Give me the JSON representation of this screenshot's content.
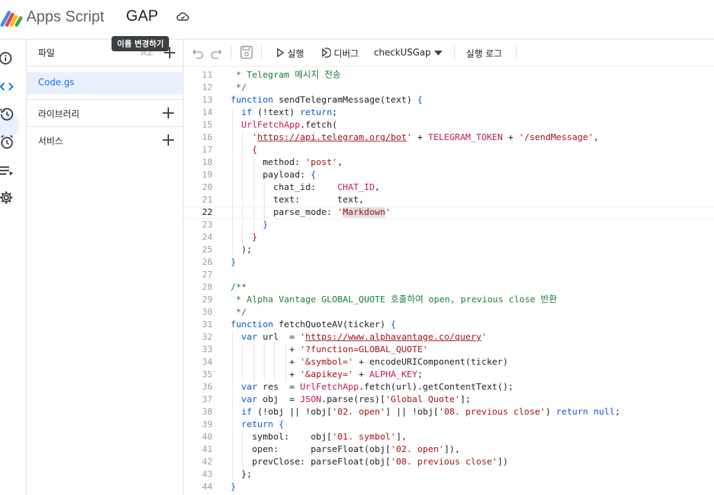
{
  "header": {
    "app_name": "Apps Script",
    "project_name": "GAP",
    "rename_tooltip": "이름 변경하기"
  },
  "rail": {
    "icons": [
      "info-icon",
      "code-icon",
      "history-icon",
      "triggers-icon",
      "executions-icon",
      "settings-icon"
    ],
    "active": "code-icon"
  },
  "file_panel": {
    "files_label": "파일",
    "sort_label": "AZ",
    "files": [
      "Code.gs"
    ],
    "libraries_label": "라이브러리",
    "services_label": "서비스"
  },
  "toolbar": {
    "run_label": "실행",
    "debug_label": "디버그",
    "function_selected": "checkUSGap",
    "exec_log_label": "실행 로그"
  },
  "editor": {
    "current_line": 22,
    "lines": [
      {
        "n": "11",
        "indent": 0,
        "tokens": [
          [
            " * Telegram 메시지 전송",
            "cm"
          ]
        ]
      },
      {
        "n": "12",
        "indent": 0,
        "tokens": [
          [
            " */",
            "cm"
          ]
        ]
      },
      {
        "n": "13",
        "indent": 0,
        "tokens": [
          [
            "function",
            "kw"
          ],
          [
            " sendTelegramMessage(text) ",
            "plain"
          ],
          [
            "{",
            "brace"
          ]
        ]
      },
      {
        "n": "14",
        "indent": 1,
        "tokens": [
          [
            "  ",
            "plain"
          ],
          [
            "if",
            "kw"
          ],
          [
            " (!text) ",
            "plain"
          ],
          [
            "return",
            "kw"
          ],
          [
            ";",
            "plain"
          ]
        ]
      },
      {
        "n": "15",
        "indent": 1,
        "tokens": [
          [
            "  ",
            "plain"
          ],
          [
            "UrlFetchApp",
            "const"
          ],
          [
            ".fetch(",
            "plain"
          ]
        ]
      },
      {
        "n": "16",
        "indent": 2,
        "tokens": [
          [
            "    '",
            "str"
          ],
          [
            "https://api.telegram.org/bot",
            "url"
          ],
          [
            "'",
            "str"
          ],
          [
            " + ",
            "plain"
          ],
          [
            "TELEGRAM_TOKEN",
            "const"
          ],
          [
            " + ",
            "plain"
          ],
          [
            "'/sendMessage'",
            "str"
          ],
          [
            ",",
            "plain"
          ]
        ]
      },
      {
        "n": "17",
        "indent": 2,
        "tokens": [
          [
            "    {",
            "str"
          ]
        ]
      },
      {
        "n": "18",
        "indent": 3,
        "tokens": [
          [
            "      method: ",
            "plain"
          ],
          [
            "'post'",
            "str"
          ],
          [
            ",",
            "plain"
          ]
        ]
      },
      {
        "n": "19",
        "indent": 3,
        "tokens": [
          [
            "      payload: ",
            "plain"
          ],
          [
            "{",
            "brace"
          ]
        ]
      },
      {
        "n": "20",
        "indent": 4,
        "tokens": [
          [
            "        chat_id:    ",
            "plain"
          ],
          [
            "CHAT_ID",
            "const"
          ],
          [
            ",",
            "plain"
          ]
        ]
      },
      {
        "n": "21",
        "indent": 4,
        "tokens": [
          [
            "        text:       text,",
            "plain"
          ]
        ]
      },
      {
        "n": "22",
        "indent": 4,
        "tokens": [
          [
            "        parse_mode: ",
            "plain"
          ],
          [
            "'",
            "str"
          ],
          [
            "Markdown",
            "str-hl"
          ],
          [
            "'",
            "str"
          ]
        ]
      },
      {
        "n": "23",
        "indent": 3,
        "tokens": [
          [
            "      ",
            "plain"
          ],
          [
            "}",
            "brace"
          ]
        ]
      },
      {
        "n": "24",
        "indent": 2,
        "tokens": [
          [
            "    }",
            "str"
          ]
        ]
      },
      {
        "n": "25",
        "indent": 1,
        "tokens": [
          [
            "  );",
            "plain"
          ]
        ]
      },
      {
        "n": "26",
        "indent": 0,
        "tokens": [
          [
            "}",
            "brace"
          ]
        ]
      },
      {
        "n": "27",
        "indent": 0,
        "tokens": []
      },
      {
        "n": "28",
        "indent": 0,
        "tokens": [
          [
            "/**",
            "cm"
          ]
        ]
      },
      {
        "n": "29",
        "indent": 0,
        "tokens": [
          [
            " * Alpha Vantage GLOBAL_QUOTE 호출하여 open, previous close 반환",
            "cm"
          ]
        ]
      },
      {
        "n": "30",
        "indent": 0,
        "tokens": [
          [
            " */",
            "cm"
          ]
        ]
      },
      {
        "n": "31",
        "indent": 0,
        "tokens": [
          [
            "function",
            "kw"
          ],
          [
            " fetchQuoteAV(ticker) ",
            "plain"
          ],
          [
            "{",
            "brace"
          ]
        ]
      },
      {
        "n": "32",
        "indent": 1,
        "tokens": [
          [
            "  ",
            "plain"
          ],
          [
            "var",
            "kw"
          ],
          [
            " url  = ",
            "plain"
          ],
          [
            "'",
            "str"
          ],
          [
            "https://www.alphavantage.co/query",
            "url"
          ],
          [
            "'",
            "str"
          ]
        ]
      },
      {
        "n": "33",
        "indent": 6,
        "tokens": [
          [
            "           + ",
            "plain"
          ],
          [
            "'?function=GLOBAL_QUOTE'",
            "str"
          ]
        ]
      },
      {
        "n": "34",
        "indent": 6,
        "tokens": [
          [
            "           + ",
            "plain"
          ],
          [
            "'&symbol='",
            "str"
          ],
          [
            " + encodeURIComponent(ticker)",
            "plain"
          ]
        ]
      },
      {
        "n": "35",
        "indent": 6,
        "tokens": [
          [
            "           + ",
            "plain"
          ],
          [
            "'&apikey='",
            "str"
          ],
          [
            " + ",
            "plain"
          ],
          [
            "ALPHA_KEY",
            "const"
          ],
          [
            ";",
            "plain"
          ]
        ]
      },
      {
        "n": "36",
        "indent": 1,
        "tokens": [
          [
            "  ",
            "plain"
          ],
          [
            "var",
            "kw"
          ],
          [
            " res  = ",
            "plain"
          ],
          [
            "UrlFetchApp",
            "const"
          ],
          [
            ".fetch(url).getContentText();",
            "plain"
          ]
        ]
      },
      {
        "n": "37",
        "indent": 1,
        "tokens": [
          [
            "  ",
            "plain"
          ],
          [
            "var",
            "kw"
          ],
          [
            " obj  = ",
            "plain"
          ],
          [
            "JSON",
            "const"
          ],
          [
            ".parse(res)[",
            "plain"
          ],
          [
            "'Global Quote'",
            "str"
          ],
          [
            "];",
            "plain"
          ]
        ]
      },
      {
        "n": "38",
        "indent": 1,
        "tokens": [
          [
            "  ",
            "plain"
          ],
          [
            "if",
            "kw"
          ],
          [
            " (!obj || !obj[",
            "plain"
          ],
          [
            "'02. open'",
            "str"
          ],
          [
            "] || !obj[",
            "plain"
          ],
          [
            "'08. previous close'",
            "str"
          ],
          [
            ") ",
            "plain"
          ],
          [
            "return",
            "kw"
          ],
          [
            " ",
            "plain"
          ],
          [
            "null",
            "kw"
          ],
          [
            ";",
            "plain"
          ]
        ]
      },
      {
        "n": "39",
        "indent": 1,
        "tokens": [
          [
            "  ",
            "plain"
          ],
          [
            "return",
            "kw"
          ],
          [
            " ",
            "plain"
          ],
          [
            "{",
            "brace"
          ]
        ]
      },
      {
        "n": "40",
        "indent": 2,
        "tokens": [
          [
            "    symbol:    obj[",
            "plain"
          ],
          [
            "'01. symbol'",
            "str"
          ],
          [
            "],",
            "plain"
          ]
        ]
      },
      {
        "n": "41",
        "indent": 2,
        "tokens": [
          [
            "    open:      parseFloat(obj[",
            "plain"
          ],
          [
            "'02. open'",
            "str"
          ],
          [
            "]),",
            "plain"
          ]
        ]
      },
      {
        "n": "42",
        "indent": 2,
        "tokens": [
          [
            "    prevClose: parseFloat(obj[",
            "plain"
          ],
          [
            "'08. previous close'",
            "str"
          ],
          [
            "])",
            "plain"
          ]
        ]
      },
      {
        "n": "43",
        "indent": 1,
        "tokens": [
          [
            "  };",
            "plain"
          ]
        ]
      },
      {
        "n": "44",
        "indent": 0,
        "tokens": [
          [
            "}",
            "brace"
          ]
        ]
      }
    ]
  },
  "colors": {
    "accent": "#1a73e8",
    "active_bg": "#e8f0fe",
    "keyword": "#0b57d0",
    "string": "#a31515",
    "comment": "#188038",
    "constant": "#c2185b"
  }
}
